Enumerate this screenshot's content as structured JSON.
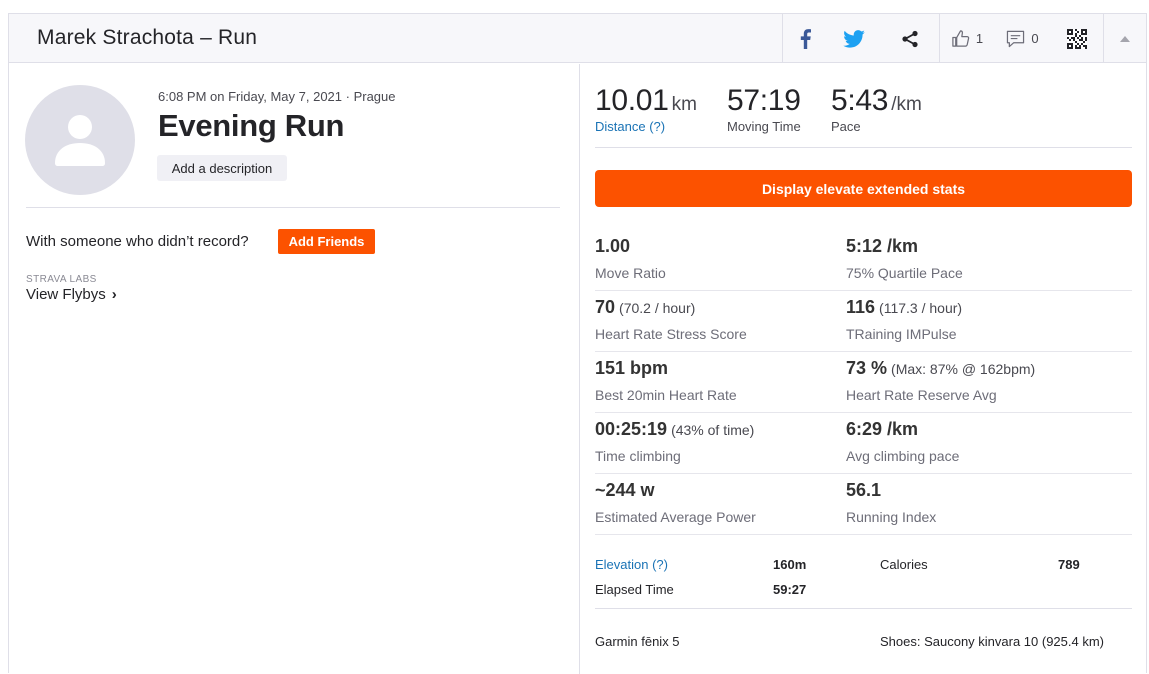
{
  "header": {
    "title": "Marek Strachota – Run",
    "kudos_count": "1",
    "comment_count": "0"
  },
  "left": {
    "date_line": "6:08 PM on Friday, May 7, 2021 · Prague",
    "activity_name": "Evening Run",
    "add_description": "Add a description",
    "with_someone": "With someone who didn’t record?",
    "add_friends": "Add Friends",
    "labs_label": "STRAVA LABS",
    "view_flybys": "View Flybys",
    "chevron": "›"
  },
  "stats": {
    "distance": {
      "value": "10.01",
      "unit": "km",
      "label": "Distance (?)"
    },
    "moving_time": {
      "value": "57:19",
      "label": "Moving Time"
    },
    "pace": {
      "value": "5:43",
      "unit": "/km",
      "label": "Pace"
    }
  },
  "elevate_button": "Display elevate extended stats",
  "extended": [
    {
      "left": {
        "value": "1.00",
        "sub": "",
        "label": "Move Ratio"
      },
      "right": {
        "value": "5:12 /km",
        "sub": "",
        "label": "75% Quartile Pace"
      }
    },
    {
      "left": {
        "value": "70",
        "sub": "(70.2 / hour)",
        "label": "Heart Rate Stress Score"
      },
      "right": {
        "value": "116",
        "sub": "(117.3 / hour)",
        "label": "TRaining IMPulse"
      }
    },
    {
      "left": {
        "value": "151 bpm",
        "sub": "",
        "label": "Best 20min Heart Rate"
      },
      "right": {
        "value": "73 %",
        "sub": "(Max: 87% @ 162bpm)",
        "label": "Heart Rate Reserve Avg"
      }
    },
    {
      "left": {
        "value": "00:25:19",
        "sub": "(43% of time)",
        "label": "Time climbing"
      },
      "right": {
        "value": "6:29 /km",
        "sub": "",
        "label": "Avg climbing pace"
      }
    },
    {
      "left": {
        "value": "~244 w",
        "sub": "",
        "label": "Estimated Average Power"
      },
      "right": {
        "value": "56.1",
        "sub": "",
        "label": "Running Index"
      }
    }
  ],
  "more": {
    "elevation_label": "Elevation (?)",
    "elevation_value": "160m",
    "calories_label": "Calories",
    "calories_value": "789",
    "elapsed_label": "Elapsed Time",
    "elapsed_value": "59:27"
  },
  "device": "Garmin fēnix 5",
  "shoes": "Shoes: Saucony kinvara 10 (925.4 km)",
  "colors": {
    "accent": "#fc5200",
    "link": "#1a73b5",
    "facebook": "#3b5998",
    "twitter": "#1da1f2"
  }
}
